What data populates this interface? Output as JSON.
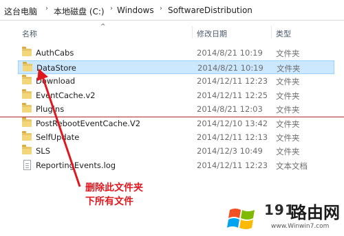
{
  "breadcrumb": [
    "这台电脑",
    "本地磁盘 (C:)",
    "Windows",
    "SoftwareDistribution"
  ],
  "columns": {
    "name": "名称",
    "date": "修改日期",
    "type": "类型"
  },
  "rows": [
    {
      "name": "AuthCabs",
      "date": "2014/8/21 10:19",
      "type": "文件夹",
      "icon": "folder-icon"
    },
    {
      "name": "DataStore",
      "date": "2014/8/21 10:19",
      "type": "文件夹",
      "icon": "folder-icon"
    },
    {
      "name": "Download",
      "date": "2014/12/11 12:23",
      "type": "文件夹",
      "icon": "folder-icon"
    },
    {
      "name": "EventCache.v2",
      "date": "2014/12/11 12:25",
      "type": "文件夹",
      "icon": "folder-icon"
    },
    {
      "name": "Plugins",
      "date": "2014/8/21 12:03",
      "type": "文件夹",
      "icon": "folder-icon"
    },
    {
      "name": "PostRebootEventCache.V2",
      "date": "2014/12/10 13:42",
      "type": "文件夹",
      "icon": "folder-icon"
    },
    {
      "name": "SelfUpdate",
      "date": "2014/12/11 12:13",
      "type": "文件夹",
      "icon": "folder-icon"
    },
    {
      "name": "SLS",
      "date": "2014/12/3 10:49",
      "type": "文件夹",
      "icon": "folder-icon"
    },
    {
      "name": "ReportingEvents.log",
      "date": "2014/12/11 12:23",
      "type": "文本文档",
      "icon": "text-file-icon"
    }
  ],
  "annotation": [
    "删除此文件夹",
    "下所有文件"
  ],
  "watermark": {
    "number": "191",
    "cn": "路由网",
    "url": "www.Winwin7.com"
  },
  "colors": {
    "selection": "#cce8ff",
    "annotation": "#e0181e",
    "folder": "#e8c566"
  }
}
